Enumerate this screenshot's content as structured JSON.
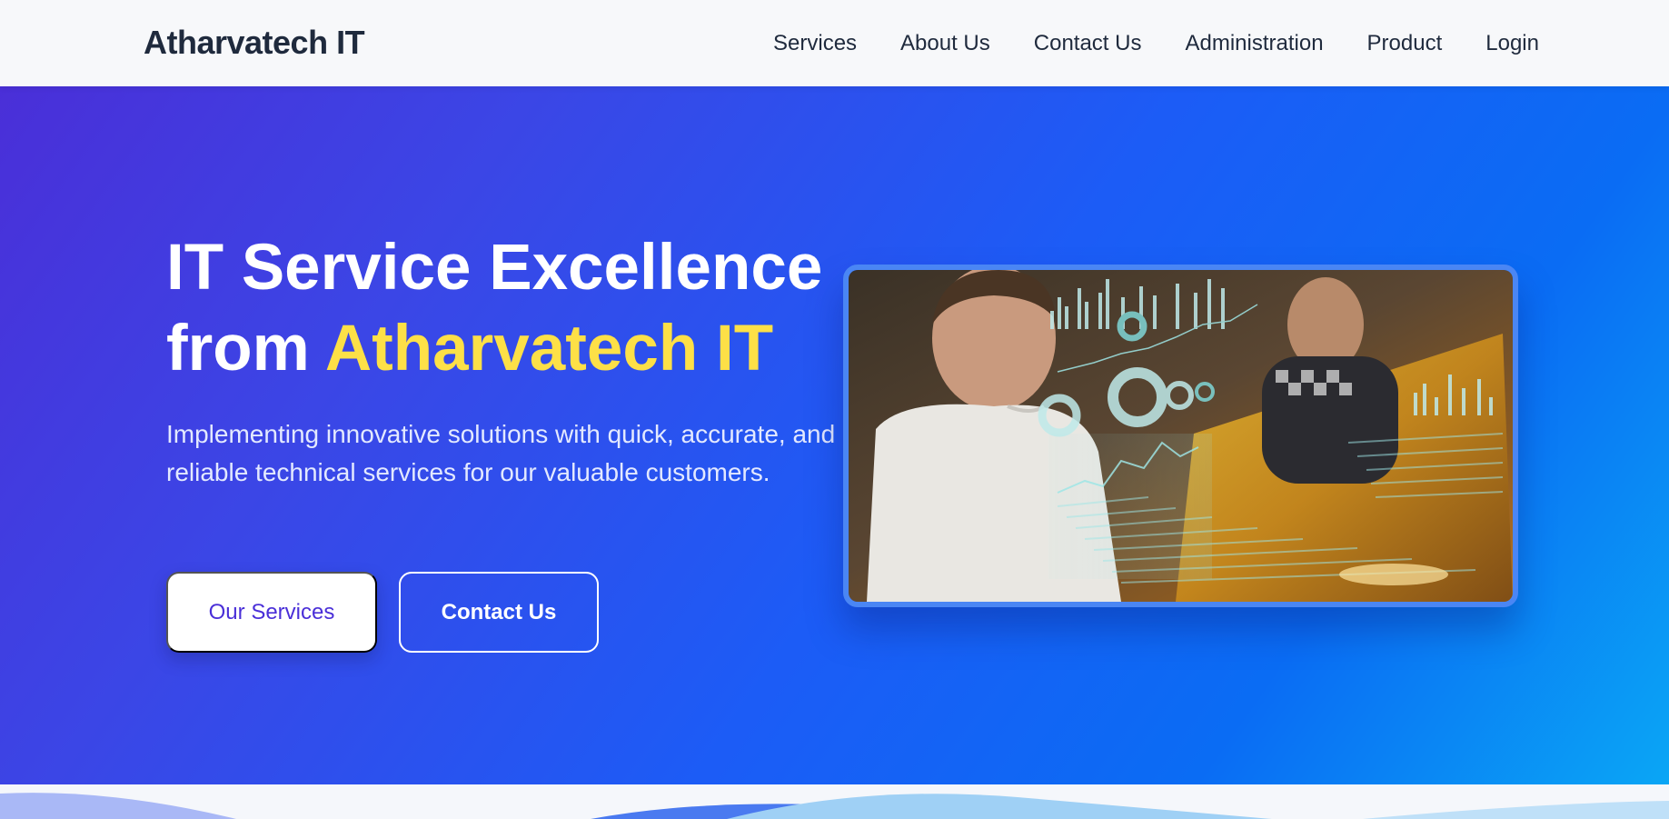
{
  "brand": {
    "name": "Atharvatech IT"
  },
  "nav": {
    "items": [
      {
        "label": "Services"
      },
      {
        "label": "About Us"
      },
      {
        "label": "Contact Us"
      },
      {
        "label": "Administration"
      },
      {
        "label": "Product"
      },
      {
        "label": "Login"
      }
    ]
  },
  "hero": {
    "headline_line1": "IT Service Excellence",
    "headline_from": "from",
    "headline_accent": "Atharvatech IT",
    "subtext": "Implementing innovative solutions with quick, accurate, and reliable technical services for our valuable customers.",
    "primary_button": "Our Services",
    "secondary_button": "Contact Us"
  },
  "colors": {
    "accent_yellow": "#fde047",
    "primary_purple": "#4a2fd8",
    "hero_blue": "#1c5cf6",
    "nav_text": "#1f2a3d"
  }
}
